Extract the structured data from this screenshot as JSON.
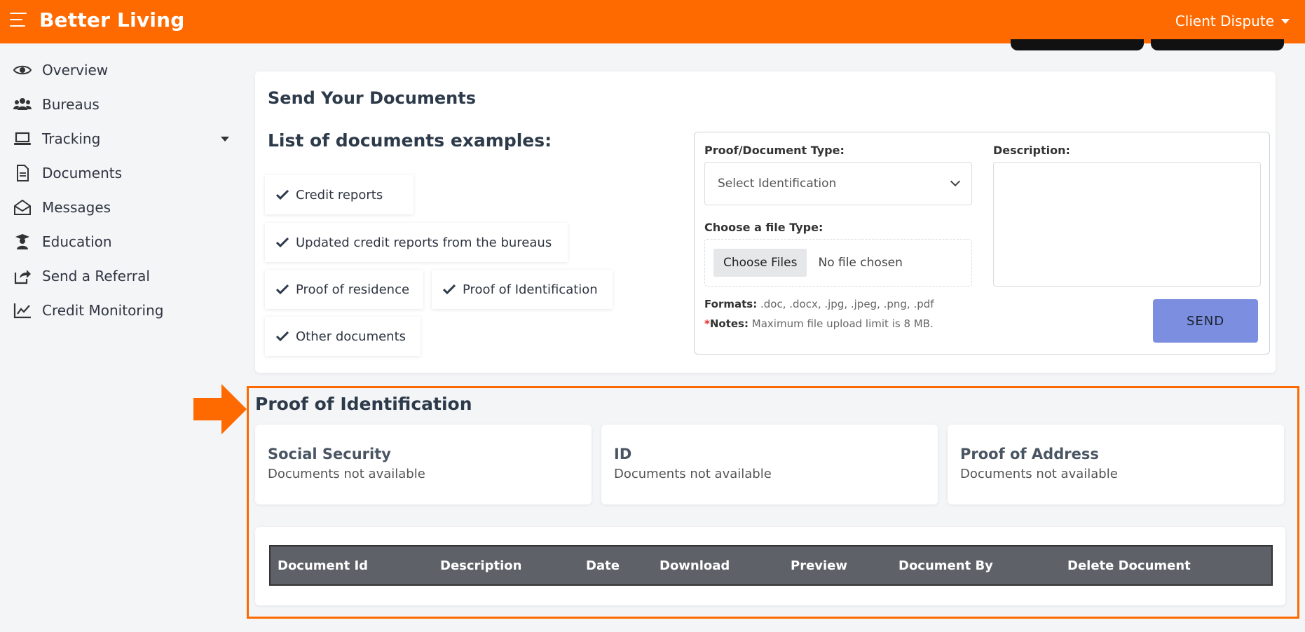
{
  "app": {
    "title": "Better Living",
    "user_menu": "Client Dispute"
  },
  "sidebar": {
    "items": [
      {
        "label": "Overview",
        "icon": "eye-icon"
      },
      {
        "label": "Bureaus",
        "icon": "users-icon"
      },
      {
        "label": "Tracking",
        "icon": "laptop-icon"
      },
      {
        "label": "Documents",
        "icon": "file-icon"
      },
      {
        "label": "Messages",
        "icon": "envelope-open-icon"
      },
      {
        "label": "Education",
        "icon": "graduate-icon"
      },
      {
        "label": "Send a Referral",
        "icon": "share-icon"
      },
      {
        "label": "Credit Monitoring",
        "icon": "chart-line-icon"
      }
    ]
  },
  "send_documents": {
    "title": "Send Your Documents",
    "list_title": "List of documents examples:",
    "examples": [
      "Credit reports",
      "Updated credit reports from the bureaus",
      "Proof of residence",
      "Proof of Identification",
      "Other documents"
    ],
    "form": {
      "type_label": "Proof/Document Type:",
      "type_selected": "Select Identification",
      "description_label": "Description:",
      "file_label": "Choose a file Type:",
      "file_button": "Choose Files",
      "file_status": "No file chosen",
      "formats_label": "Formats:",
      "formats_value": ".doc, .docx, .jpg, .jpeg, .png, .pdf",
      "notes_marker": "*",
      "notes_label": "Notes:",
      "notes_value": "Maximum file upload limit is 8 MB.",
      "send_label": "SEND"
    }
  },
  "proof_section": {
    "title": "Proof of Identification",
    "cards": [
      {
        "title": "Social Security",
        "status": "Documents not available"
      },
      {
        "title": "ID",
        "status": "Documents not available"
      },
      {
        "title": "Proof of Address",
        "status": "Documents not available"
      }
    ],
    "table_headers": [
      "Document Id",
      "Description",
      "Date",
      "Download",
      "Preview",
      "Document By",
      "Delete Document"
    ]
  },
  "colors": {
    "brand": "#ff6a00",
    "send_button": "#7b8ee0",
    "table_header": "#5e6268"
  }
}
